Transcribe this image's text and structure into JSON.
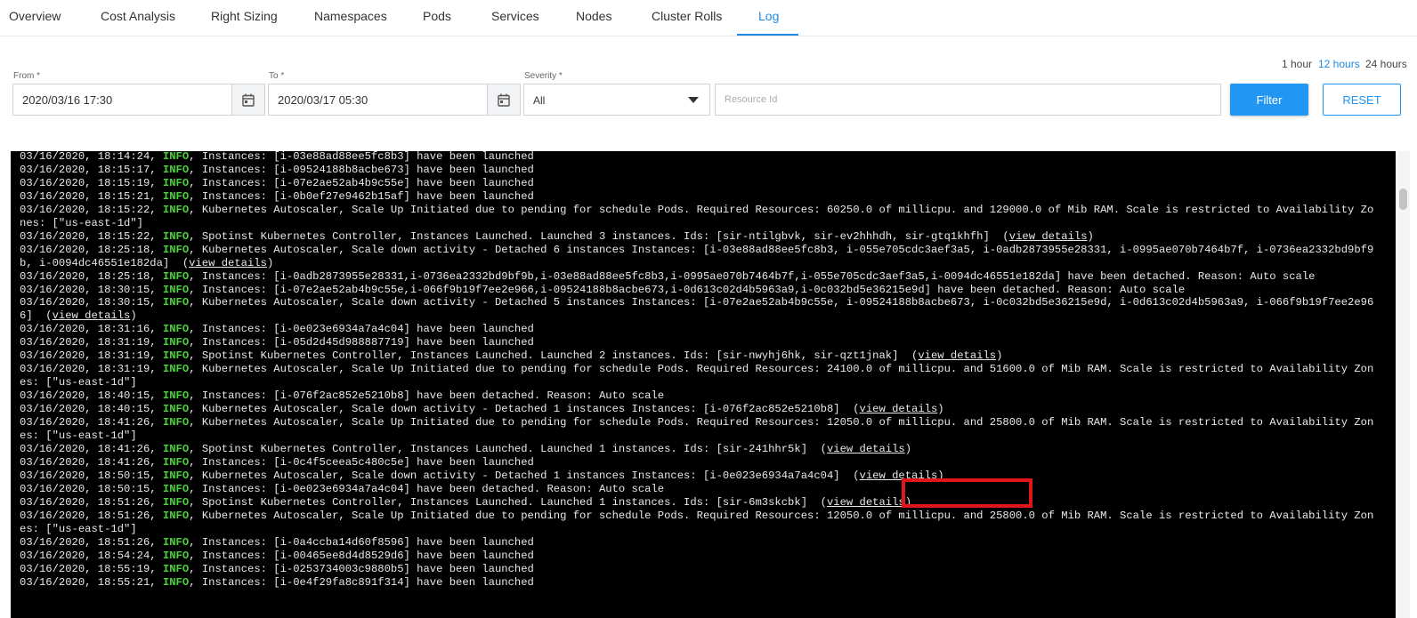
{
  "tabs": [
    {
      "label": "Overview",
      "active": false
    },
    {
      "label": "Cost Analysis",
      "active": false
    },
    {
      "label": "Right Sizing",
      "active": false
    },
    {
      "label": "Namespaces",
      "active": false
    },
    {
      "label": "Pods",
      "active": false
    },
    {
      "label": "Services",
      "active": false
    },
    {
      "label": "Nodes",
      "active": false
    },
    {
      "label": "Cluster Rolls",
      "active": false
    },
    {
      "label": "Log",
      "active": true
    }
  ],
  "quick_ranges": [
    {
      "label": "1 hour",
      "active": false
    },
    {
      "label": "12 hours",
      "active": true
    },
    {
      "label": "24 hours",
      "active": false
    }
  ],
  "filters": {
    "from": {
      "label": "From *",
      "value": "2020/03/16 17:30"
    },
    "to": {
      "label": "To *",
      "value": "2020/03/17 05:30"
    },
    "severity": {
      "label": "Severity *",
      "value": "All"
    },
    "resource": {
      "placeholder": "Resource Id"
    },
    "filter_label": "Filter",
    "reset_label": "RESET"
  },
  "colors": {
    "accent": "#2196f3",
    "info": "#4cd13c",
    "highlight": "#e0161b",
    "console_bg": "#000000"
  },
  "log": [
    {
      "ts": "03/16/2020, 18:14:24",
      "level": "INFO",
      "msg": "Instances: [i-03e88ad88ee5fc8b3] have been launched"
    },
    {
      "ts": "03/16/2020, 18:15:17",
      "level": "INFO",
      "msg": "Instances: [i-09524188b8acbe673] have been launched"
    },
    {
      "ts": "03/16/2020, 18:15:19",
      "level": "INFO",
      "msg": "Instances: [i-07e2ae52ab4b9c55e] have been launched"
    },
    {
      "ts": "03/16/2020, 18:15:21",
      "level": "INFO",
      "msg": "Instances: [i-0b0ef27e9462b15af] have been launched"
    },
    {
      "ts": "03/16/2020, 18:15:22",
      "level": "INFO",
      "msg": "Kubernetes Autoscaler, Scale Up Initiated due to pending for schedule Pods. Required Resources: 60250.0 of millicpu. and 129000.0 of Mib RAM. Scale is restricted to Availability Zones: [\"us-east-1d\"]"
    },
    {
      "ts": "03/16/2020, 18:15:22",
      "level": "INFO",
      "msg": "Spotinst Kubernetes Controller, Instances Launched. Launched 3 instances. Ids: [sir-ntilgbvk, sir-ev2hhhdh, sir-gtq1khfh]",
      "link": "view details"
    },
    {
      "ts": "03/16/2020, 18:25:18",
      "level": "INFO",
      "msg": "Kubernetes Autoscaler, Scale down activity - Detached 6 instances Instances: [i-03e88ad88ee5fc8b3, i-055e705cdc3aef3a5, i-0adb2873955e28331, i-0995ae070b7464b7f, i-0736ea2332bd9bf9b, i-0094dc46551e182da]",
      "link": "view details"
    },
    {
      "ts": "03/16/2020, 18:25:18",
      "level": "INFO",
      "msg": "Instances: [i-0adb2873955e28331,i-0736ea2332bd9bf9b,i-03e88ad88ee5fc8b3,i-0995ae070b7464b7f,i-055e705cdc3aef3a5,i-0094dc46551e182da] have been detached. Reason: Auto scale"
    },
    {
      "ts": "03/16/2020, 18:30:15",
      "level": "INFO",
      "msg": "Instances: [i-07e2ae52ab4b9c55e,i-066f9b19f7ee2e966,i-09524188b8acbe673,i-0d613c02d4b5963a9,i-0c032bd5e36215e9d] have been detached. Reason: Auto scale"
    },
    {
      "ts": "03/16/2020, 18:30:15",
      "level": "INFO",
      "msg": "Kubernetes Autoscaler, Scale down activity - Detached 5 instances Instances: [i-07e2ae52ab4b9c55e, i-09524188b8acbe673, i-0c032bd5e36215e9d, i-0d613c02d4b5963a9, i-066f9b19f7ee2e966]",
      "link": "view details"
    },
    {
      "ts": "03/16/2020, 18:31:16",
      "level": "INFO",
      "msg": "Instances: [i-0e023e6934a7a4c04] have been launched"
    },
    {
      "ts": "03/16/2020, 18:31:19",
      "level": "INFO",
      "msg": "Instances: [i-05d2d45d988887719] have been launched"
    },
    {
      "ts": "03/16/2020, 18:31:19",
      "level": "INFO",
      "msg": "Spotinst Kubernetes Controller, Instances Launched. Launched 2 instances. Ids: [sir-nwyhj6hk, sir-qzt1jnak]",
      "link": "view details"
    },
    {
      "ts": "03/16/2020, 18:31:19",
      "level": "INFO",
      "msg": "Kubernetes Autoscaler, Scale Up Initiated due to pending for schedule Pods. Required Resources: 24100.0 of millicpu. and 51600.0 of Mib RAM. Scale is restricted to Availability Zones: [\"us-east-1d\"]"
    },
    {
      "ts": "03/16/2020, 18:40:15",
      "level": "INFO",
      "msg": "Instances: [i-076f2ac852e5210b8] have been detached. Reason: Auto scale"
    },
    {
      "ts": "03/16/2020, 18:40:15",
      "level": "INFO",
      "msg": "Kubernetes Autoscaler, Scale down activity - Detached 1 instances Instances: [i-076f2ac852e5210b8]",
      "link": "view details"
    },
    {
      "ts": "03/16/2020, 18:41:26",
      "level": "INFO",
      "msg": "Kubernetes Autoscaler, Scale Up Initiated due to pending for schedule Pods. Required Resources: 12050.0 of millicpu. and 25800.0 of Mib RAM. Scale is restricted to Availability Zones: [\"us-east-1d\"]"
    },
    {
      "ts": "03/16/2020, 18:41:26",
      "level": "INFO",
      "msg": "Spotinst Kubernetes Controller, Instances Launched. Launched 1 instances. Ids: [sir-241hhr5k]",
      "link": "view details"
    },
    {
      "ts": "03/16/2020, 18:41:26",
      "level": "INFO",
      "msg": "Instances: [i-0c4f5ceea5c480c5e] have been launched"
    },
    {
      "ts": "03/16/2020, 18:50:15",
      "level": "INFO",
      "msg": "Kubernetes Autoscaler, Scale down activity - Detached 1 instances Instances: [i-0e023e6934a7a4c04]",
      "link": "view details",
      "highlighted": true
    },
    {
      "ts": "03/16/2020, 18:50:15",
      "level": "INFO",
      "msg": "Instances: [i-0e023e6934a7a4c04] have been detached. Reason: Auto scale"
    },
    {
      "ts": "03/16/2020, 18:51:26",
      "level": "INFO",
      "msg": "Spotinst Kubernetes Controller, Instances Launched. Launched 1 instances. Ids: [sir-6m3skcbk]",
      "link": "view details"
    },
    {
      "ts": "03/16/2020, 18:51:26",
      "level": "INFO",
      "msg": "Kubernetes Autoscaler, Scale Up Initiated due to pending for schedule Pods. Required Resources: 12050.0 of millicpu. and 25800.0 of Mib RAM. Scale is restricted to Availability Zones: [\"us-east-1d\"]"
    },
    {
      "ts": "03/16/2020, 18:51:26",
      "level": "INFO",
      "msg": "Instances: [i-0a4ccba14d60f8596] have been launched"
    },
    {
      "ts": "03/16/2020, 18:54:24",
      "level": "INFO",
      "msg": "Instances: [i-00465ee8d4d8529d6] have been launched"
    },
    {
      "ts": "03/16/2020, 18:55:19",
      "level": "INFO",
      "msg": "Instances: [i-0253734003c9880b5] have been launched"
    },
    {
      "ts": "03/16/2020, 18:55:21",
      "level": "INFO",
      "msg": "Instances: [i-0e4f29fa8c891f314] have been launched"
    }
  ]
}
